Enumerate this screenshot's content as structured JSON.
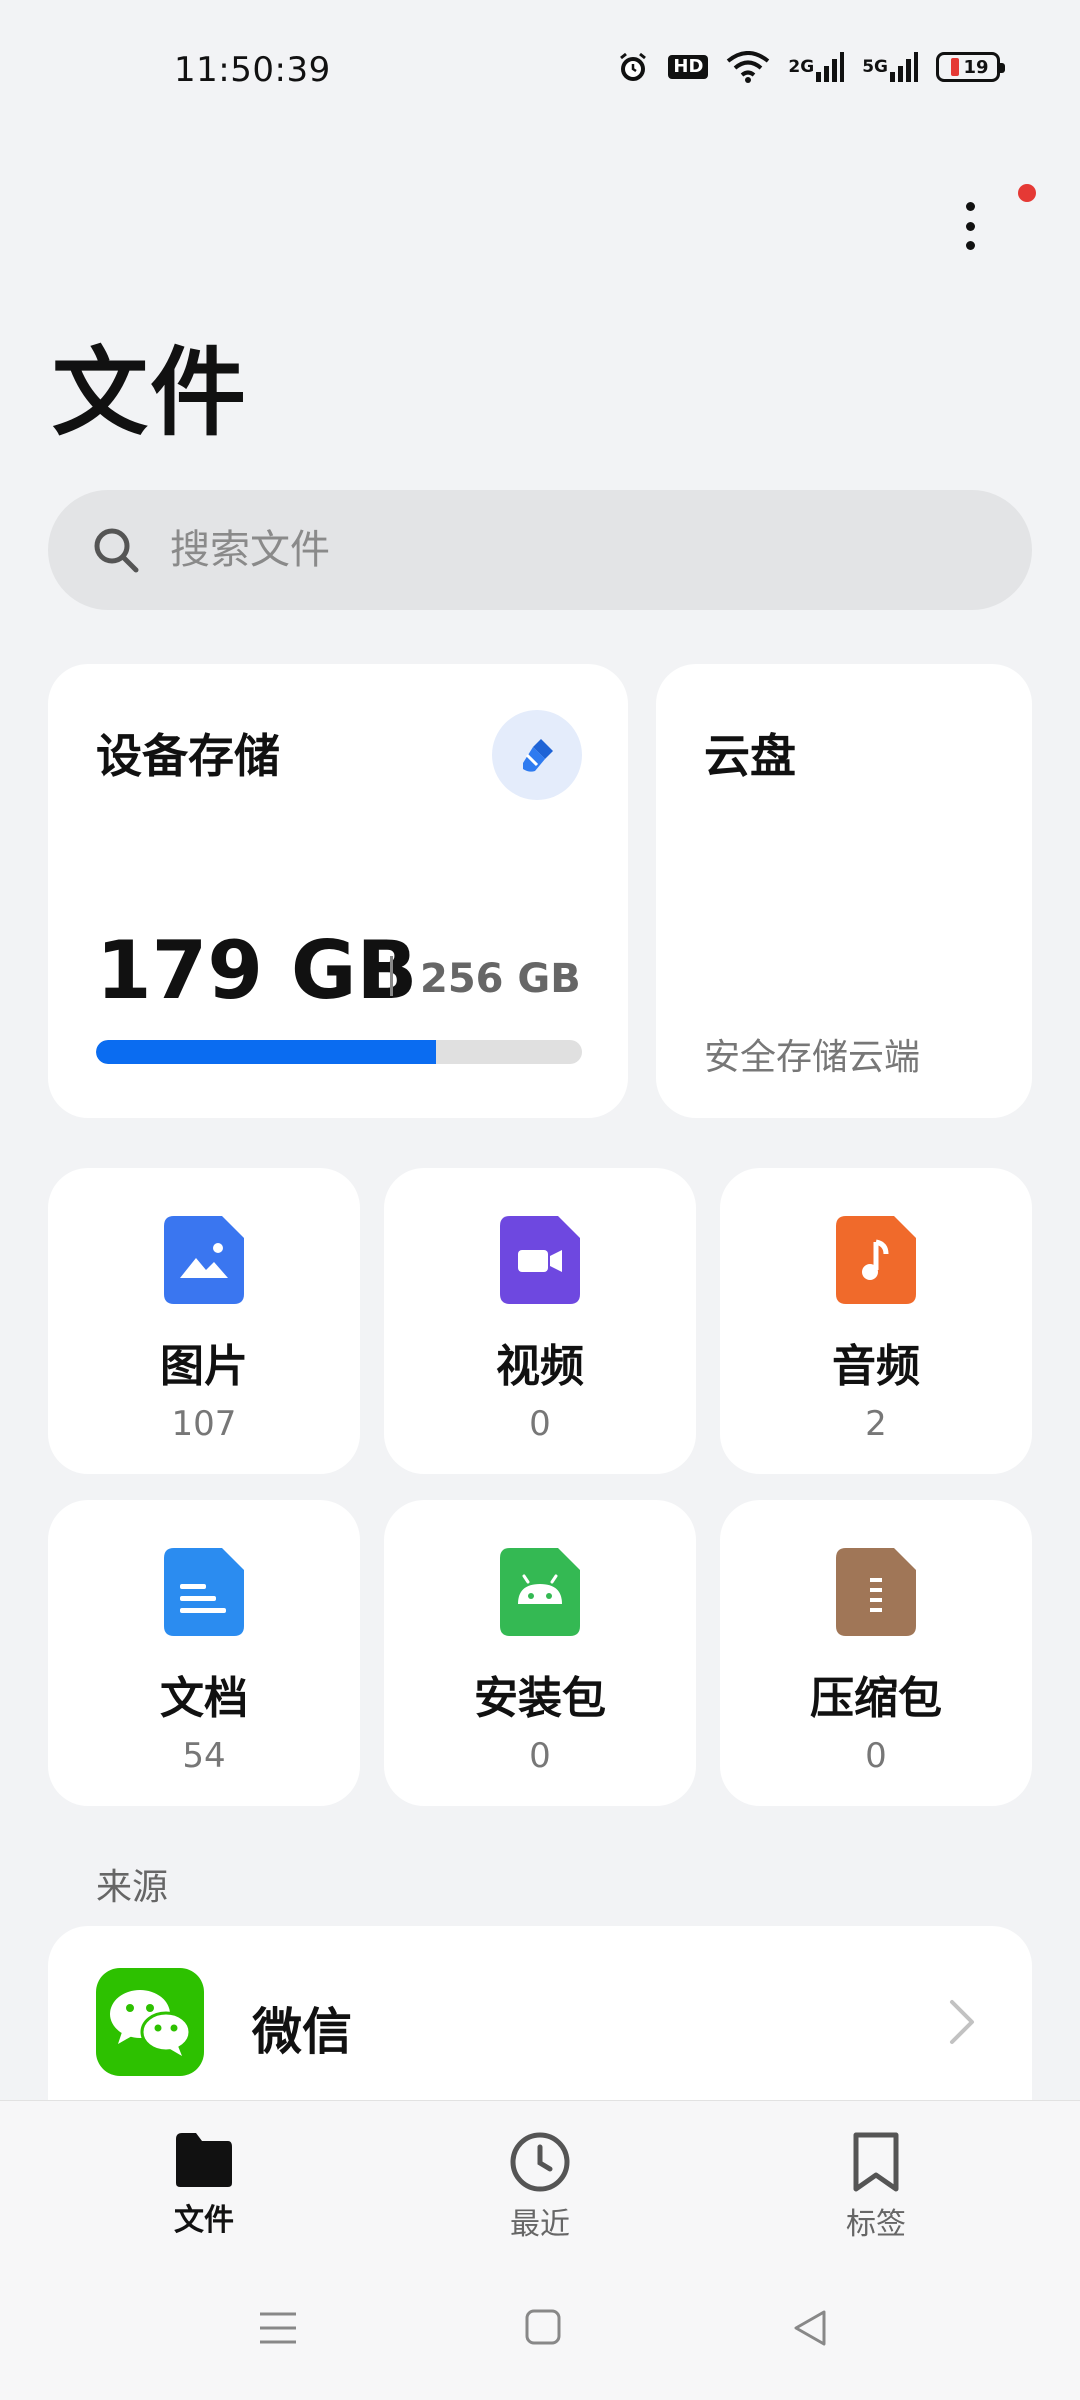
{
  "status_bar": {
    "time": "11:50:39",
    "hd_label": "HD",
    "net_2g": "2G",
    "net_5g": "5G",
    "battery_level": "19",
    "icons": [
      "alarm-icon",
      "hd-icon",
      "wifi-icon",
      "signal-2g-icon",
      "signal-5g-icon",
      "battery-icon"
    ]
  },
  "header": {
    "title": "文件",
    "more_icon": "more-vertical-icon"
  },
  "search": {
    "placeholder": "搜索文件"
  },
  "storage": {
    "title": "设备存储",
    "used": "179 GB",
    "total": "256 GB",
    "used_fraction": 0.7,
    "accent": "#0a6cf1"
  },
  "cloud": {
    "title": "云盘",
    "description": "安全存储云端"
  },
  "categories": [
    {
      "label": "图片",
      "count": "107",
      "icon": "image-file-icon",
      "color": "#3a76f0"
    },
    {
      "label": "视频",
      "count": "0",
      "icon": "video-file-icon",
      "color": "#6e48e0"
    },
    {
      "label": "音频",
      "count": "2",
      "icon": "audio-file-icon",
      "color": "#f06a2b"
    },
    {
      "label": "文档",
      "count": "54",
      "icon": "document-file-icon",
      "color": "#2b8cf0"
    },
    {
      "label": "安装包",
      "count": "0",
      "icon": "android-package-icon",
      "color": "#34b953"
    },
    {
      "label": "压缩包",
      "count": "0",
      "icon": "archive-file-icon",
      "color": "#a07657"
    }
  ],
  "sources": {
    "section_label": "来源",
    "items": [
      {
        "label": "微信",
        "icon": "wechat-icon"
      }
    ]
  },
  "bottom_nav": {
    "items": [
      {
        "label": "文件",
        "icon": "folder-icon",
        "active": true
      },
      {
        "label": "最近",
        "icon": "clock-icon",
        "active": false
      },
      {
        "label": "标签",
        "icon": "bookmark-icon",
        "active": false
      }
    ]
  }
}
